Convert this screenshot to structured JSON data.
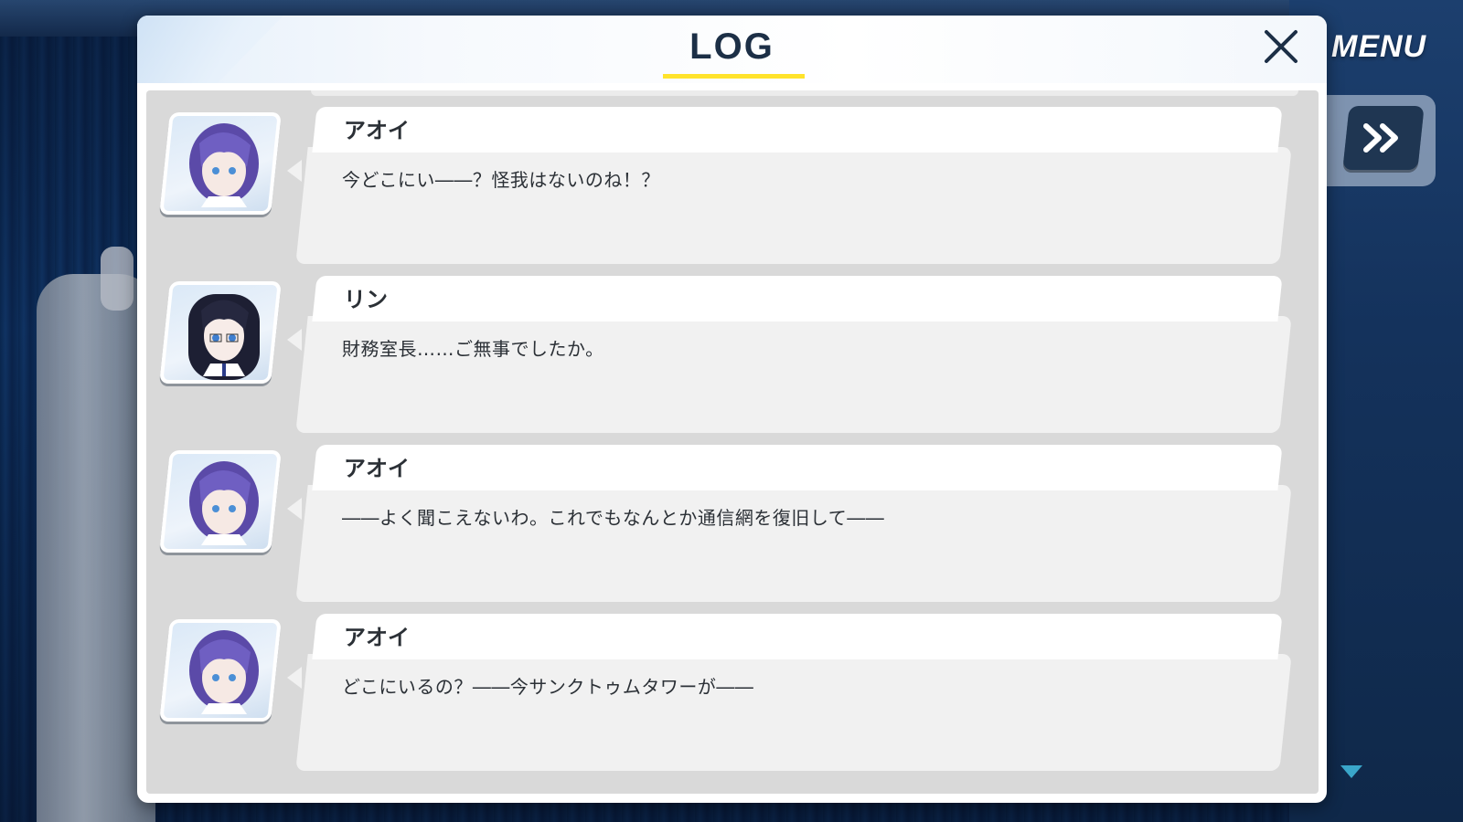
{
  "hud": {
    "menu_label": "MENU",
    "fast_forward_icon": "double-chevron-right-icon",
    "scroll_indicator_icon": "triangle-down-icon"
  },
  "log": {
    "title": "LOG",
    "close_icon": "close-icon",
    "entries": [
      {
        "speaker": "アオイ",
        "portrait": "aoi-portrait",
        "text": "今どこにい――？怪我はないのね！？"
      },
      {
        "speaker": "リン",
        "portrait": "rin-portrait",
        "text": "財務室長……ご無事でしたか。"
      },
      {
        "speaker": "アオイ",
        "portrait": "aoi-portrait",
        "text": "――よく聞こえないわ。これでもなんとか通信網を復旧して――"
      },
      {
        "speaker": "アオイ",
        "portrait": "aoi-portrait",
        "text": "どこにいるの？――今サンクトゥムタワーが――"
      }
    ]
  },
  "colors": {
    "title_underline": "#ffe32b",
    "title_text": "#1c2f46",
    "scroll_arrow": "#3aa6c9",
    "ff_button_bg": "#1f3652"
  }
}
